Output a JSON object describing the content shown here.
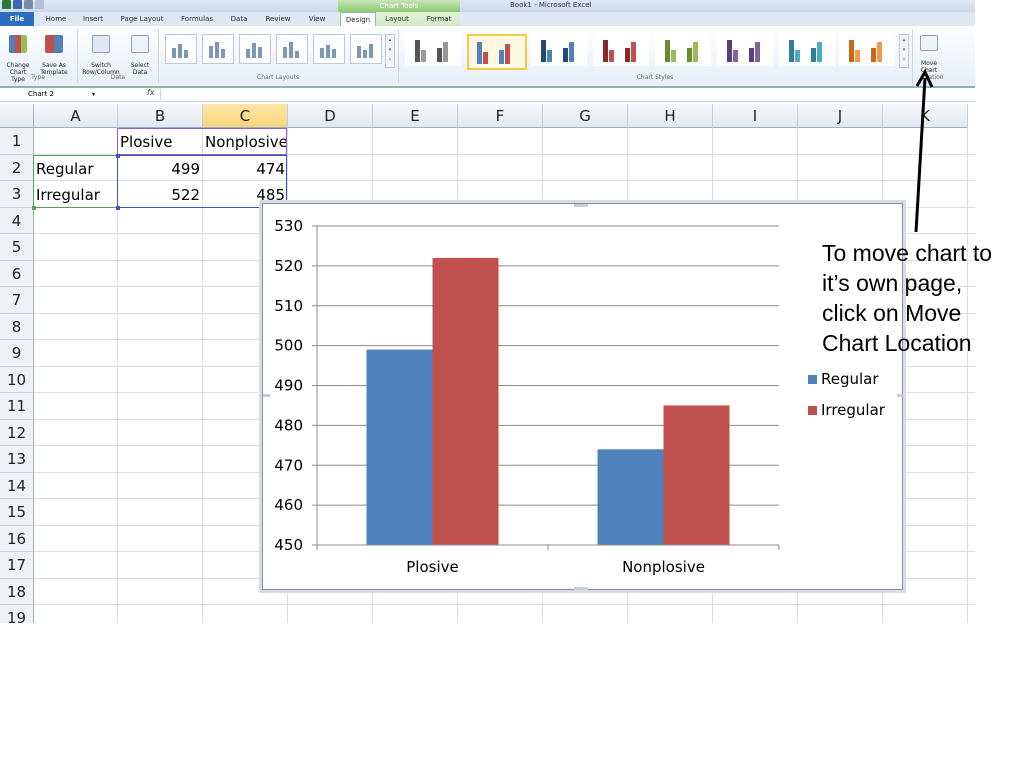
{
  "window": {
    "title": "Book1  -  Microsoft Excel",
    "context_tab_group": "Chart Tools"
  },
  "tabs": [
    "File",
    "Home",
    "Insert",
    "Page Layout",
    "Formulas",
    "Data",
    "Review",
    "View",
    "Design",
    "Layout",
    "Format"
  ],
  "active_tab": "Design",
  "ribbon": {
    "type_group": {
      "label": "Type",
      "change_chart_type": "Change\nChart Type",
      "save_as_template": "Save As\nTemplate"
    },
    "data_group": {
      "label": "Data",
      "switch_row_column": "Switch\nRow/Column",
      "select_data": "Select\nData"
    },
    "layouts_group": {
      "label": "Chart Layouts"
    },
    "styles_group": {
      "label": "Chart Styles"
    },
    "location_group": {
      "label": "Location",
      "label_visible": "ation",
      "move_chart": "Move\nChart"
    }
  },
  "formula_bar": {
    "name_box": "Chart 2",
    "fx": "fx"
  },
  "columns": [
    "A",
    "B",
    "C",
    "D",
    "E",
    "F",
    "G",
    "H",
    "I",
    "J",
    "K"
  ],
  "selected_column": "C",
  "rows": [
    "1",
    "2",
    "3",
    "4",
    "5",
    "6",
    "7",
    "8",
    "9",
    "10",
    "11",
    "12",
    "13",
    "14",
    "15",
    "16",
    "17",
    "18",
    "19"
  ],
  "sheet": {
    "B1": "Plosive",
    "C1": "Nonplosive",
    "A2": "Regular",
    "B2": "499",
    "C2": "474",
    "A3": "Irregular",
    "B3": "522",
    "C3": "485"
  },
  "chart_data": {
    "type": "bar",
    "categories": [
      "Plosive",
      "Nonplosive"
    ],
    "series": [
      {
        "name": "Regular",
        "values": [
          499,
          474
        ],
        "color": "#4f81bd"
      },
      {
        "name": "Irregular",
        "values": [
          522,
          485
        ],
        "color": "#c0504d"
      }
    ],
    "ylim": [
      450,
      530
    ],
    "yticks": [
      450,
      460,
      470,
      480,
      490,
      500,
      510,
      520,
      530
    ],
    "grid": true,
    "legend_position": "right"
  },
  "annotation": {
    "text": "To move chart to\nit’s own page,\nclick on Move\nChart Location"
  },
  "colors": {
    "accent": "#2a6ebb",
    "chart_tools": "#8dc873",
    "selected_column": "#f8d47b"
  }
}
